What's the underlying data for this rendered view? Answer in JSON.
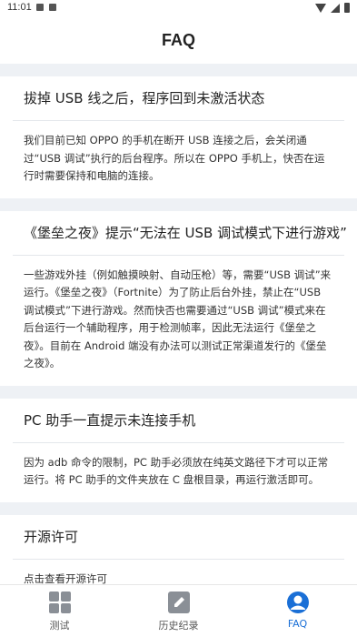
{
  "status_bar": {
    "time": "11:01"
  },
  "header": {
    "title": "FAQ"
  },
  "faq": [
    {
      "title": "拔掉 USB 线之后，程序回到未激活状态",
      "body": "我们目前已知 OPPO 的手机在断开 USB 连接之后，会关闭通过“USB 调试”执行的后台程序。所以在 OPPO 手机上，快否在运行时需要保持和电脑的连接。"
    },
    {
      "title": "《堡垒之夜》提示“无法在 USB 调试模式下进行游戏”",
      "body": "一些游戏外挂（例如触摸映射、自动压枪）等，需要“USB 调试”来运行。《堡垒之夜》（Fortnite）为了防止后台外挂，禁止在“USB 调试模式”下进行游戏。然而快否也需要通过“USB 调试”模式来在后台运行一个辅助程序，用于检测帧率，因此无法运行《堡垒之夜》。目前在 Android 端没有办法可以测试正常渠道发行的《堡垒之夜》。"
    },
    {
      "title": "PC 助手一直提示未连接手机",
      "body": "因为 adb 命令的限制，PC 助手必须放在纯英文路径下才可以正常运行。将 PC 助手的文件夹放在 C 盘根目录，再运行激活即可。"
    },
    {
      "title": "开源许可",
      "body": "点击查看开源许可"
    }
  ],
  "bottom_nav": {
    "items": [
      {
        "label": "测试",
        "icon": "grid-icon"
      },
      {
        "label": "历史纪录",
        "icon": "edit-history-icon"
      },
      {
        "label": "FAQ",
        "icon": "user-icon"
      }
    ],
    "active_index": 2
  },
  "colors": {
    "accent": "#1a6fd6",
    "background": "#eef1f5"
  }
}
